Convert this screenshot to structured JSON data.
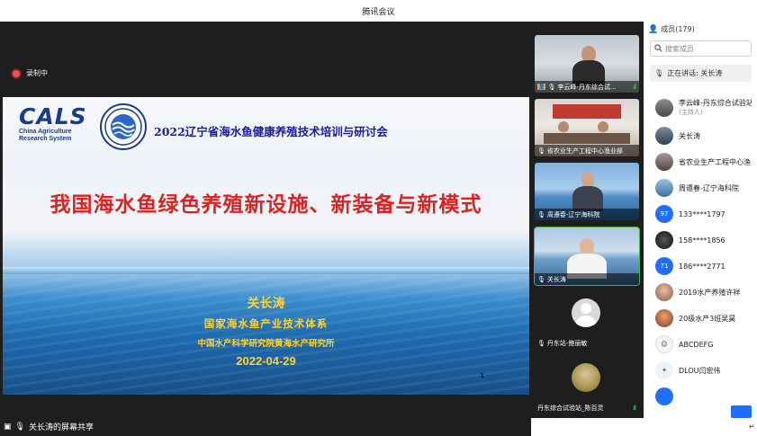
{
  "window": {
    "title": "腾讯会议"
  },
  "recording": {
    "label": "录制中"
  },
  "slide": {
    "logo_letters": "CALS",
    "logo_line1": "China Agriculture",
    "logo_line2": "Research System",
    "conference_title": "2022辽宁省海水鱼健康养殖技术培训与研讨会",
    "main_title": "我国海水鱼绿色养殖新设施、新装备与新模式",
    "speaker": "关长涛",
    "org_line1": "国家海水鱼产业技术体系",
    "org_line2": "中国水产科学研究院黄海水产研究所",
    "date": "2022-04-29",
    "page_number": "1"
  },
  "share_status": {
    "label": "关长涛的屏幕共享"
  },
  "video_tiles": [
    {
      "name": "李云峰-丹东综合试...",
      "speaking": true
    },
    {
      "name": "省农业生产工程中心渔业部",
      "speaking": false
    },
    {
      "name": "周遵春-辽宁海科院",
      "speaking": false
    },
    {
      "name": "关长涛",
      "speaking": false,
      "active": true
    },
    {
      "name": "丹东站-鲍丽敏",
      "speaking": false
    },
    {
      "name": "丹东综合试验站_陈百灵",
      "speaking": true
    }
  ],
  "members_panel": {
    "header": "成员(179)",
    "search_placeholder": "搜索成员",
    "speaking_now": "正在讲话: 关长涛",
    "members": [
      {
        "name": "李云峰-丹东综合试验站",
        "sub": "(主持人)",
        "avatar": "photo"
      },
      {
        "name": "关长涛",
        "sub": "",
        "avatar": "photo"
      },
      {
        "name": "省农业生产工程中心渔",
        "sub": "",
        "avatar": "photo"
      },
      {
        "name": "周遵春-辽宁海科院",
        "sub": "",
        "avatar": "photo"
      },
      {
        "name": "133****1797",
        "sub": "",
        "avatar": "97",
        "color": "#1e6fff"
      },
      {
        "name": "158****1856",
        "sub": "",
        "avatar": "photo"
      },
      {
        "name": "186****2771",
        "sub": "",
        "avatar": "71",
        "color": "#1e6fff"
      },
      {
        "name": "2019水产养殖许祥",
        "sub": "",
        "avatar": "photo"
      },
      {
        "name": "20级水产3班吴昊",
        "sub": "",
        "avatar": "photo"
      },
      {
        "name": "ABCDEFG",
        "sub": "",
        "avatar": "photo"
      },
      {
        "name": "DLOU闫宏伟",
        "sub": "",
        "avatar": "photo"
      }
    ]
  },
  "colors": {
    "accent": "#1e6fff",
    "speaking_green": "#37d03e",
    "record_red": "#ff4d4f",
    "title_red": "#e02020",
    "slide_gold": "#ffd22e"
  }
}
